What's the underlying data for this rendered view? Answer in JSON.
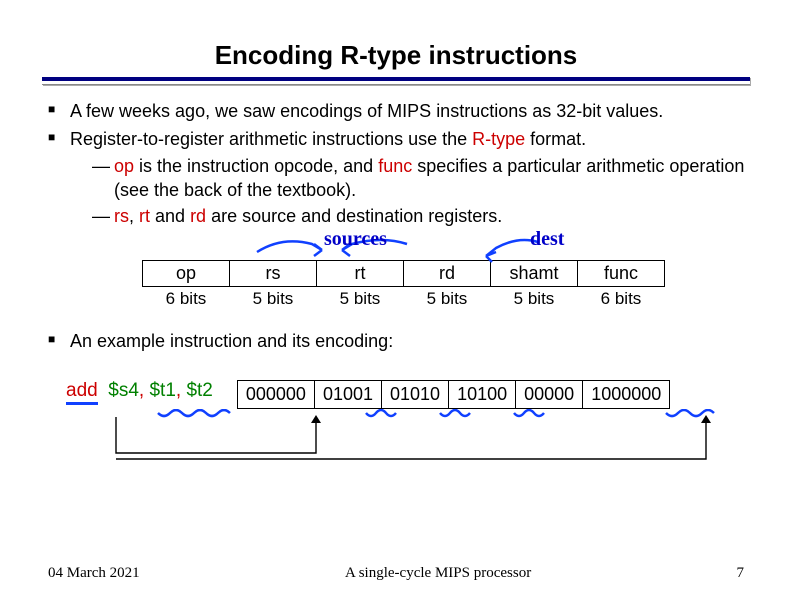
{
  "title": "Encoding R-type instructions",
  "bullets": {
    "b1": "A few weeks ago, we saw encodings of MIPS instructions as 32-bit values.",
    "b2_pre": "Register-to-register arithmetic instructions use the ",
    "b2_rtype": "R-type",
    "b2_post": " format.",
    "s1_pre": "",
    "s1_op": "op",
    "s1_mid1": " is the instruction opcode, and ",
    "s1_func": "func",
    "s1_post": " specifies a particular arithmetic operation (see the back of the textbook).",
    "s2_rs": "rs",
    "s2_c1": ", ",
    "s2_rt": "rt",
    "s2_c2": " and ",
    "s2_rd": "rd",
    "s2_post": " are source and destination registers.",
    "b3": "An example instruction and its encoding:"
  },
  "annot": {
    "sources": "sources",
    "dest": "dest"
  },
  "fields": {
    "names": [
      "op",
      "rs",
      "rt",
      "rd",
      "shamt",
      "func"
    ],
    "bits": [
      "6 bits",
      "5 bits",
      "5 bits",
      "5 bits",
      "5 bits",
      "6 bits"
    ]
  },
  "example": {
    "mnemonic": "add",
    "args_s4": "$s4",
    "comma1": ", ",
    "args_t1": "$t1",
    "comma2": ", ",
    "args_t2": "$t2",
    "enc": [
      "000000",
      "01001",
      "01010",
      "10100",
      "00000",
      "1000000"
    ]
  },
  "footer": {
    "date": "04 March 2021",
    "center": "A single-cycle MIPS processor",
    "page": "7"
  }
}
